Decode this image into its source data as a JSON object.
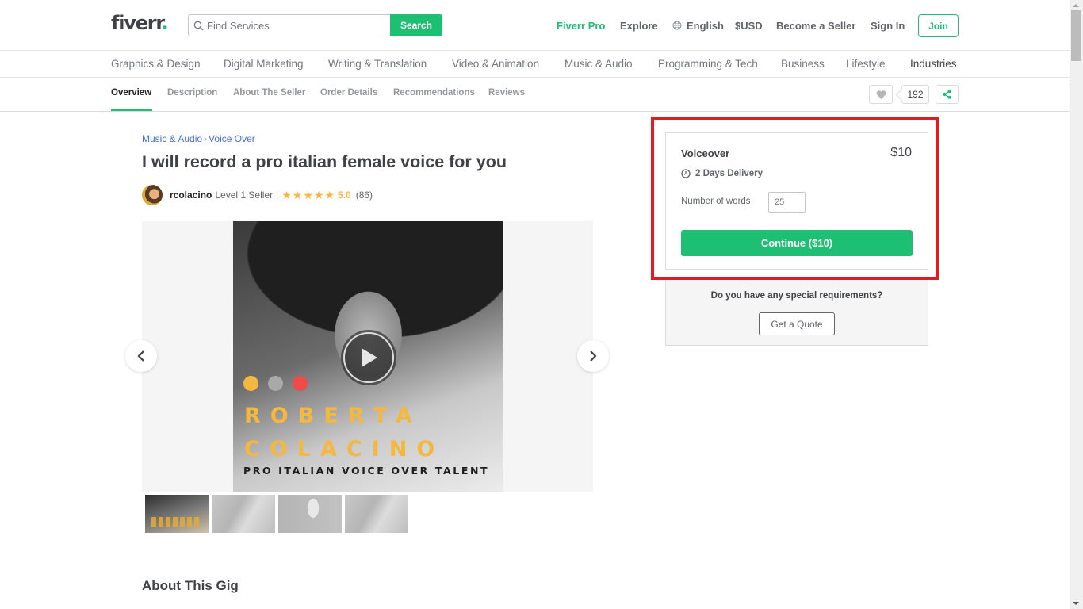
{
  "header": {
    "logo": "fiverr",
    "logo_dot": ".",
    "search_placeholder": "Find Services",
    "search_button": "Search",
    "nav": {
      "pro": "Fiverr Pro",
      "explore": "Explore",
      "language": "English",
      "currency": "$USD",
      "become_seller": "Become a Seller",
      "sign_in": "Sign In",
      "join": "Join"
    }
  },
  "categories": [
    "Graphics & Design",
    "Digital Marketing",
    "Writing & Translation",
    "Video & Animation",
    "Music & Audio",
    "Programming & Tech",
    "Business",
    "Lifestyle",
    "Industries"
  ],
  "gig_nav": {
    "tabs": [
      "Overview",
      "Description",
      "About The Seller",
      "Order Details",
      "Recommendations",
      "Reviews"
    ],
    "active": "Overview",
    "likes": "192"
  },
  "gig": {
    "breadcrumb": [
      "Music & Audio",
      "Voice Over"
    ],
    "breadcrumb_sep": "›",
    "title": "I will record a pro italian female voice for you",
    "seller": {
      "name": "rcolacino",
      "level": "Level 1 Seller",
      "divider": "|",
      "stars": 5,
      "rating": "5.0",
      "reviews": "(86)"
    },
    "media": {
      "overlay_line1": "ROBERTA",
      "overlay_line2": "COLACINO",
      "overlay_tagline": "PRO ITALIAN VOICE OVER TALENT",
      "dot_colors": [
        "#f4b740",
        "#a9a9a9",
        "#ef4b4b"
      ],
      "thumbnail_count": 4
    },
    "about_title": "About This Gig"
  },
  "package": {
    "name": "Voiceover",
    "price": "$10",
    "delivery": "2 Days Delivery",
    "words_label": "Number of words",
    "words_value": "25",
    "continue": "Continue ($10)"
  },
  "quote": {
    "question": "Do you have any special requirements?",
    "button": "Get a Quote"
  },
  "colors": {
    "brand_green": "#1dbf73",
    "highlight_red": "#e01b24",
    "star_yellow": "#ffb33e",
    "link_blue": "#446ee7"
  }
}
